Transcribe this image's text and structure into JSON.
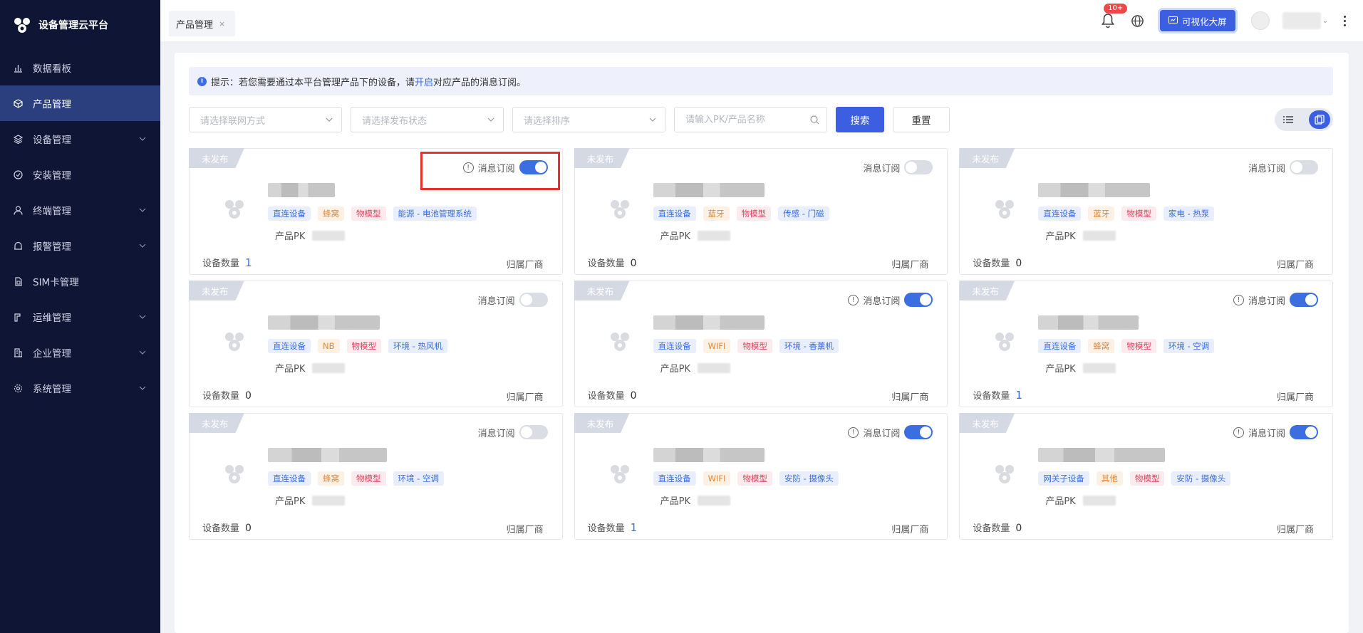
{
  "brand": {
    "title": "设备管理云平台"
  },
  "sidebar": {
    "items": [
      {
        "label": "数据看板",
        "icon": "bar-chart-icon",
        "active": false,
        "expandable": false
      },
      {
        "label": "产品管理",
        "icon": "cube-icon",
        "active": true,
        "expandable": false
      },
      {
        "label": "设备管理",
        "icon": "layers-icon",
        "active": false,
        "expandable": true
      },
      {
        "label": "安装管理",
        "icon": "check-circle-icon",
        "active": false,
        "expandable": false
      },
      {
        "label": "终端管理",
        "icon": "user-icon",
        "active": false,
        "expandable": true
      },
      {
        "label": "报警管理",
        "icon": "alarm-icon",
        "active": false,
        "expandable": true
      },
      {
        "label": "SIM卡管理",
        "icon": "sim-card-icon",
        "active": false,
        "expandable": false
      },
      {
        "label": "运维管理",
        "icon": "tool-icon",
        "active": false,
        "expandable": true
      },
      {
        "label": "企业管理",
        "icon": "building-icon",
        "active": false,
        "expandable": true
      },
      {
        "label": "系统管理",
        "icon": "gear-icon",
        "active": false,
        "expandable": true
      }
    ]
  },
  "topbar": {
    "tab_label": "产品管理",
    "tab_close": "×",
    "notification_badge": "10+",
    "visual_button_label": "可视化大屏"
  },
  "notice": {
    "prefix": "提示：若您需要通过本平台管理产品下的设备，请",
    "link": "开启",
    "suffix": "对应产品的消息订阅。"
  },
  "filters": {
    "network_placeholder": "请选择联网方式",
    "status_placeholder": "请选择发布状态",
    "sort_placeholder": "请选择排序",
    "search_placeholder": "请输入PK/产品名称",
    "search_button": "搜索",
    "reset_button": "重置"
  },
  "card_labels": {
    "status": "未发布",
    "subscribe": "消息订阅",
    "pk": "产品PK",
    "device_count": "设备数量",
    "vendor": "归属厂商"
  },
  "products": [
    {
      "tags": [
        "直连设备",
        "蜂窝",
        "物模型",
        "能源 - 电池管理系统"
      ],
      "tag_colors": [
        "blue",
        "orange",
        "red",
        "blue"
      ],
      "subscribed": true,
      "show_alert": true,
      "device_count": "1",
      "name_width_pct": 18
    },
    {
      "tags": [
        "直连设备",
        "蓝牙",
        "物模型",
        "传感 - 门磁"
      ],
      "tag_colors": [
        "blue",
        "orange",
        "red",
        "blue"
      ],
      "subscribed": false,
      "show_alert": false,
      "device_count": "0",
      "name_width_pct": 30
    },
    {
      "tags": [
        "直连设备",
        "蓝牙",
        "物模型",
        "家电 - 热泵"
      ],
      "tag_colors": [
        "blue",
        "orange",
        "red",
        "blue"
      ],
      "subscribed": false,
      "show_alert": false,
      "device_count": "0",
      "name_width_pct": 30
    },
    {
      "tags": [
        "直连设备",
        "NB",
        "物模型",
        "环境 - 热风机"
      ],
      "tag_colors": [
        "blue",
        "orange",
        "red",
        "blue"
      ],
      "subscribed": false,
      "show_alert": false,
      "device_count": "0",
      "name_width_pct": 30
    },
    {
      "tags": [
        "直连设备",
        "WIFI",
        "物模型",
        "环境 - 香薰机"
      ],
      "tag_colors": [
        "blue",
        "orange",
        "red",
        "blue"
      ],
      "subscribed": true,
      "show_alert": true,
      "device_count": "0",
      "name_width_pct": 30
    },
    {
      "tags": [
        "直连设备",
        "蜂窝",
        "物模型",
        "环境 - 空调"
      ],
      "tag_colors": [
        "blue",
        "orange",
        "red",
        "blue"
      ],
      "subscribed": true,
      "show_alert": true,
      "device_count": "1",
      "name_width_pct": 27
    },
    {
      "tags": [
        "直连设备",
        "蜂窝",
        "物模型",
        "环境 - 空调"
      ],
      "tag_colors": [
        "blue",
        "orange",
        "red",
        "blue"
      ],
      "subscribed": false,
      "show_alert": false,
      "device_count": "0",
      "name_width_pct": 32
    },
    {
      "tags": [
        "直连设备",
        "WIFI",
        "物模型",
        "安防 - 摄像头"
      ],
      "tag_colors": [
        "blue",
        "orange",
        "red",
        "blue"
      ],
      "subscribed": true,
      "show_alert": true,
      "device_count": "1",
      "name_width_pct": 30
    },
    {
      "tags": [
        "网关子设备",
        "其他",
        "物模型",
        "安防 - 摄像头"
      ],
      "tag_colors": [
        "blue",
        "orange",
        "red",
        "blue"
      ],
      "subscribed": true,
      "show_alert": true,
      "device_count": "0",
      "name_width_pct": 34
    }
  ],
  "colors": {
    "primary": "#3b5fe0",
    "sidebar_bg": "#0f1534",
    "sidebar_active": "#2b3e7e",
    "highlight": "#e8302c"
  }
}
